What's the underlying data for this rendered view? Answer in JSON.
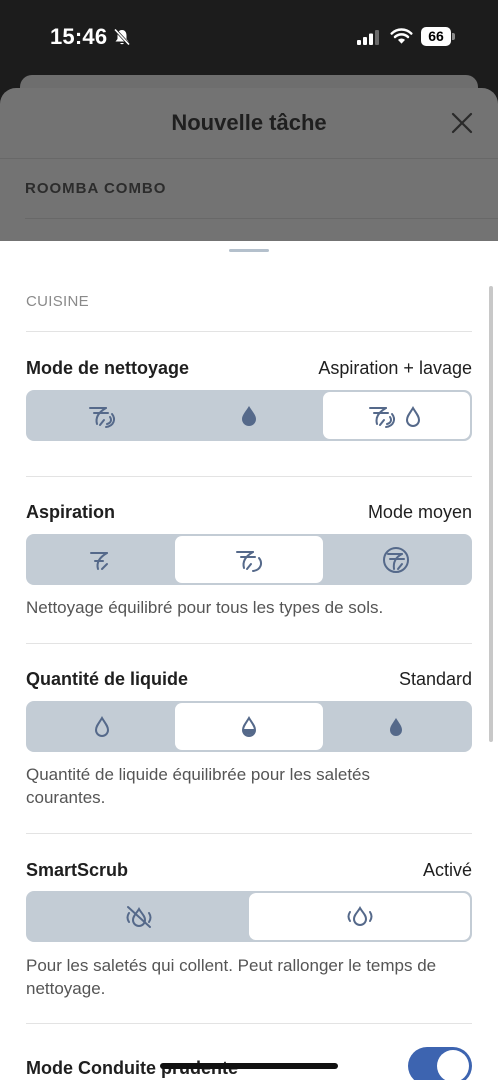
{
  "status": {
    "time": "15:46",
    "battery": "66"
  },
  "modal": {
    "title": "Nouvelle tâche",
    "subtitle": "ROOMBA COMBO"
  },
  "sheet": {
    "section": "CUISINE",
    "cleaning_mode": {
      "label": "Mode de nettoyage",
      "value": "Aspiration + lavage",
      "options": [
        "vacuum-icon",
        "water-drop-icon",
        "vacuum-and-mop-icon"
      ],
      "selected": 2
    },
    "suction": {
      "label": "Aspiration",
      "value": "Mode moyen",
      "options": [
        "suction-low-icon",
        "suction-medium-icon",
        "suction-high-icon"
      ],
      "selected": 1,
      "description": "Nettoyage équilibré pour tous les types de sols."
    },
    "liquid": {
      "label": "Quantité de liquide",
      "value": "Standard",
      "options": [
        "liquid-low-icon",
        "liquid-standard-icon",
        "liquid-high-icon"
      ],
      "selected": 1,
      "description": "Quantité de liquide équilibrée pour les saletés courantes."
    },
    "smartscrub": {
      "label": "SmartScrub",
      "value": "Activé",
      "options": [
        "smartscrub-off-icon",
        "smartscrub-on-icon"
      ],
      "selected": 1,
      "description": "Pour les saletés qui collent. Peut rallonger le temps de nettoyage."
    },
    "careful_drive": {
      "label": "Mode Conduite prudente",
      "enabled": true
    }
  },
  "colors": {
    "accent": "#3d64b0",
    "segment_bg": "#c3ccd5",
    "icon": "#55698a"
  }
}
